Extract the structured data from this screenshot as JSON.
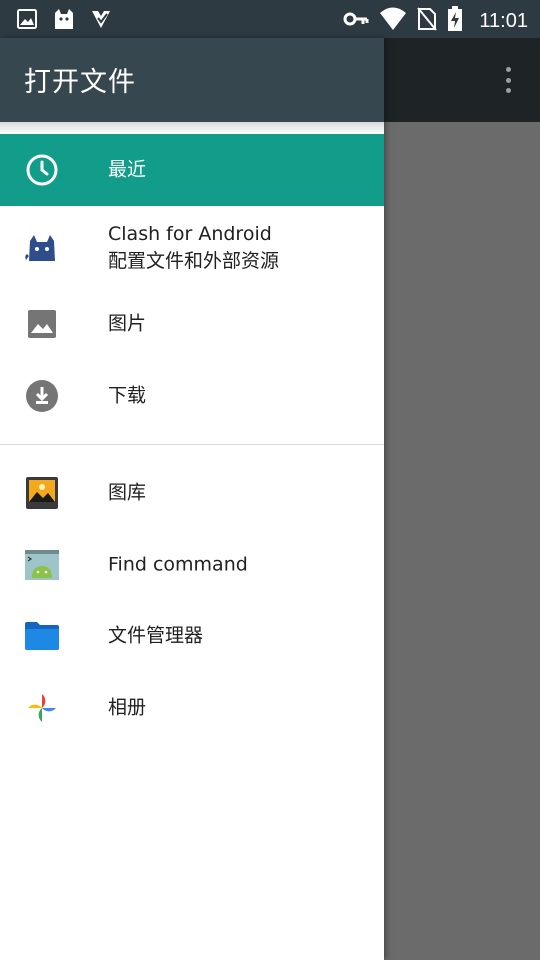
{
  "status_bar": {
    "left_icons": [
      "image-notification-icon",
      "cat-notification-icon",
      "app-notification-icon"
    ],
    "right_icons": [
      "vpn-key-icon",
      "wifi-icon",
      "no-sim-icon",
      "battery-charging-icon"
    ],
    "time": "11:01"
  },
  "drawer": {
    "title": "打开文件",
    "roots": [
      {
        "icon": "clock-icon",
        "title": "最近",
        "selected": true
      },
      {
        "icon": "clash-cat-icon",
        "title": "Clash for Android",
        "subtitle": "配置文件和外部资源"
      },
      {
        "icon": "image-icon",
        "title": "图片"
      },
      {
        "icon": "download-icon",
        "title": "下载"
      }
    ],
    "apps": [
      {
        "icon": "gallery-icon",
        "title": "图库"
      },
      {
        "icon": "android-terminal-icon",
        "title": "Find command"
      },
      {
        "icon": "folder-icon",
        "title": "文件管理器"
      },
      {
        "icon": "photos-pinwheel-icon",
        "title": "相册"
      }
    ]
  },
  "colors": {
    "accent": "#129c8a",
    "drawer_header": "#37474f",
    "status_bar": "#2e3a41",
    "scrim": "#6b6b6b"
  }
}
